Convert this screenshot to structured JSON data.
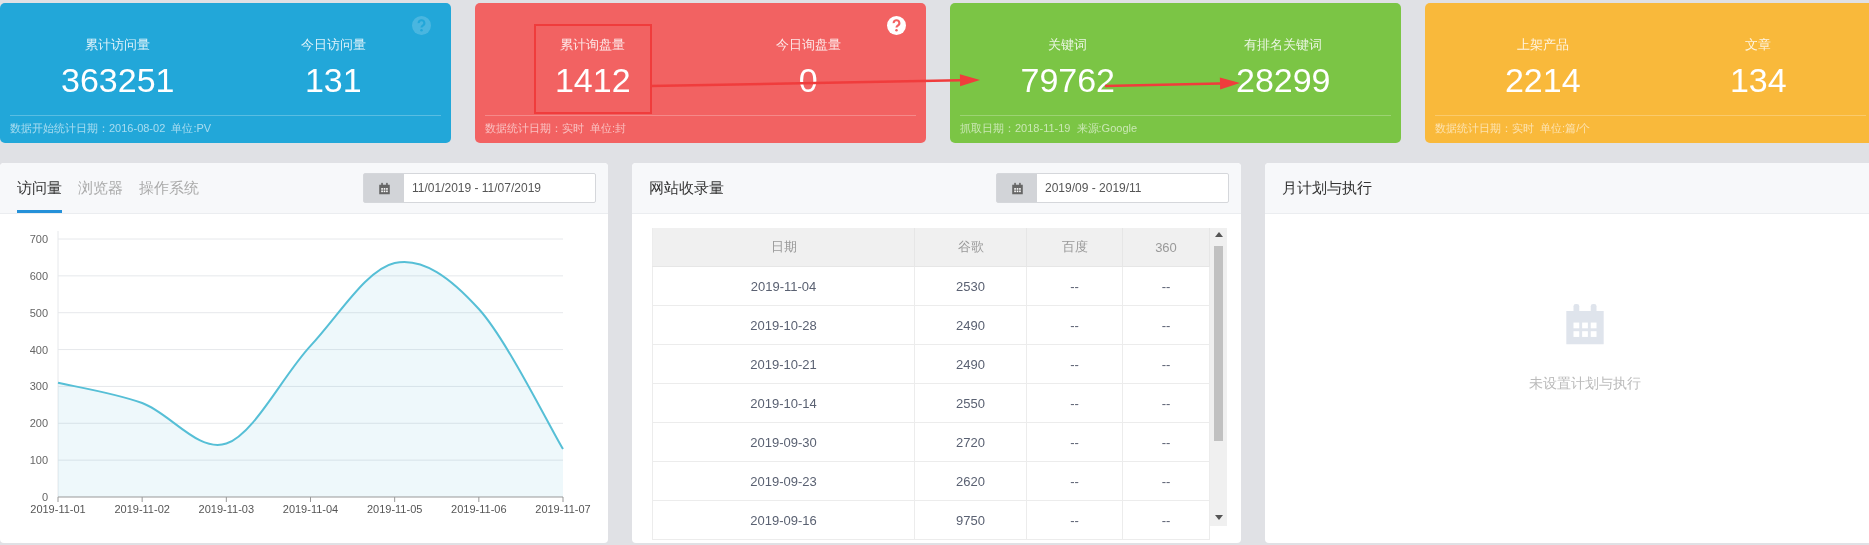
{
  "cards": [
    {
      "color": "#22a7d9",
      "help_icon": true,
      "help_icon_dimmed": true,
      "stats": [
        {
          "label": "累计访问量",
          "value": "363251",
          "highlighted": false
        },
        {
          "label": "今日访问量",
          "value": "131",
          "highlighted": false
        }
      ],
      "footer": "数据开始统计日期：2016-08-02  单位:PV"
    },
    {
      "color": "#f26262",
      "help_icon": true,
      "help_icon_dimmed": false,
      "stats": [
        {
          "label": "累计询盘量",
          "value": "1412",
          "highlighted": true
        },
        {
          "label": "今日询盘量",
          "value": "0",
          "highlighted": false
        }
      ],
      "footer": "数据统计日期：实时  单位:封"
    },
    {
      "color": "#7bc545",
      "help_icon": false,
      "stats": [
        {
          "label": "关键词",
          "value": "79762",
          "highlighted": false
        },
        {
          "label": "有排名关键词",
          "value": "28299",
          "highlighted": false
        }
      ],
      "footer": "抓取日期：2018-11-19  来源:Google"
    },
    {
      "color": "#f9b93b",
      "help_icon": false,
      "stats": [
        {
          "label": "上架产品",
          "value": "2214",
          "highlighted": false
        },
        {
          "label": "文章",
          "value": "134",
          "highlighted": false
        }
      ],
      "footer": "数据统计日期：实时  单位:篇/个"
    }
  ],
  "visits_panel": {
    "tabs": [
      {
        "label": "访问量",
        "selected": true
      },
      {
        "label": "浏览器",
        "selected": false
      },
      {
        "label": "操作系统",
        "selected": false
      }
    ],
    "date_range": "11/01/2019 - 11/07/2019",
    "chart_data": {
      "type": "area",
      "categories": [
        "2019-11-01",
        "2019-11-02",
        "2019-11-03",
        "2019-11-04",
        "2019-11-05",
        "2019-11-06",
        "2019-11-07"
      ],
      "series": [
        {
          "color": "#56bfd6",
          "values": [
            310,
            255,
            145,
            410,
            635,
            510,
            130
          ]
        }
      ],
      "grid": true,
      "ylim": [
        0,
        700
      ],
      "yticks": [
        0,
        100,
        200,
        300,
        400,
        500,
        600,
        700
      ]
    }
  },
  "index_panel": {
    "title": "网站收录量",
    "date_range": "2019/09 - 2019/11",
    "columns": [
      "日期",
      "谷歌",
      "百度",
      "360"
    ],
    "rows": [
      [
        "2019-11-04",
        "2530",
        "--",
        "--"
      ],
      [
        "2019-10-28",
        "2490",
        "--",
        "--"
      ],
      [
        "2019-10-21",
        "2490",
        "--",
        "--"
      ],
      [
        "2019-10-14",
        "2550",
        "--",
        "--"
      ],
      [
        "2019-09-30",
        "2720",
        "--",
        "--"
      ],
      [
        "2019-09-23",
        "2620",
        "--",
        "--"
      ],
      [
        "2019-09-16",
        "9750",
        "--",
        "--"
      ]
    ]
  },
  "plan_panel": {
    "title": "月计划与执行",
    "empty_text": "未设置计划与执行"
  }
}
